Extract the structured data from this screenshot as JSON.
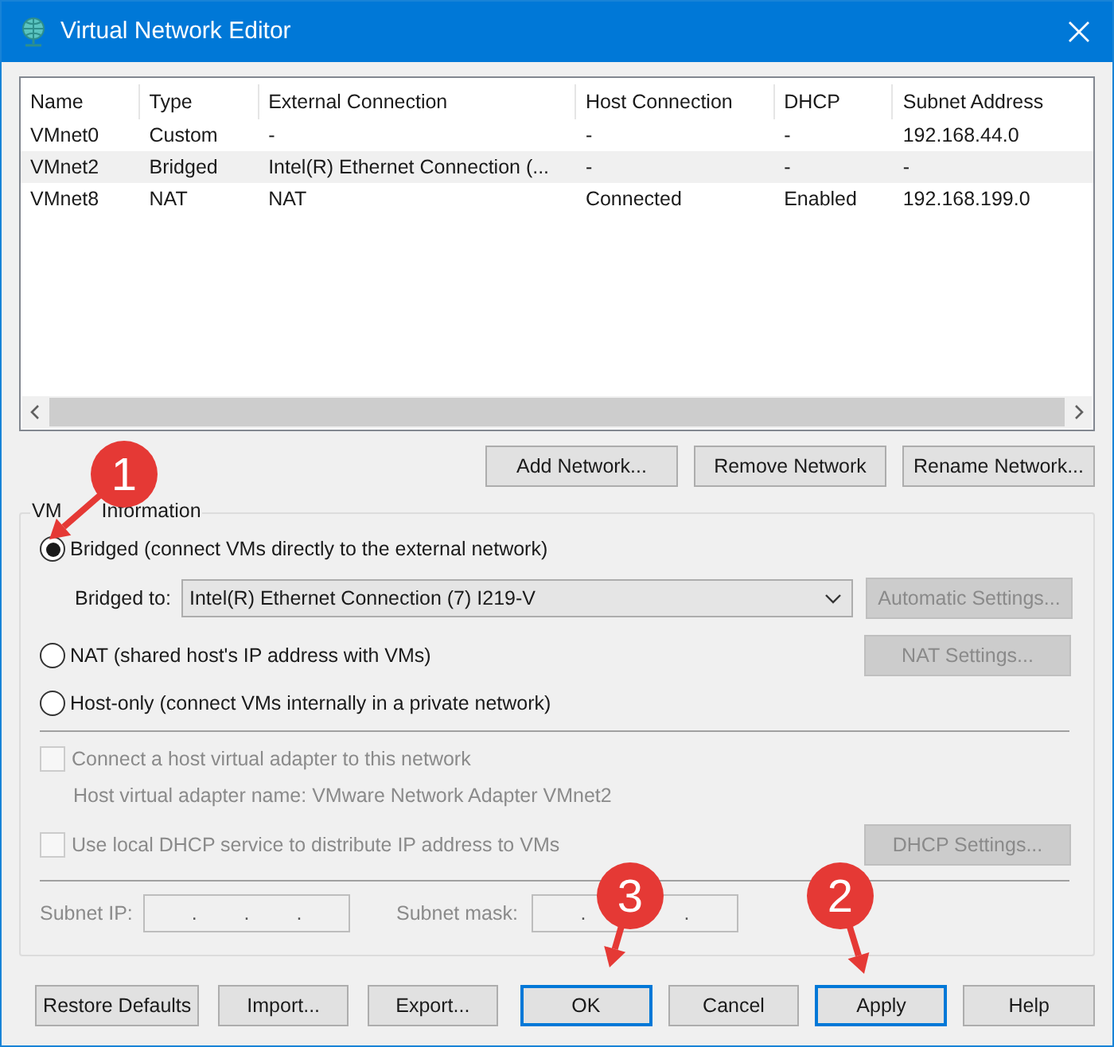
{
  "window": {
    "title": "Virtual Network Editor"
  },
  "table": {
    "columns": [
      "Name",
      "Type",
      "External Connection",
      "Host Connection",
      "DHCP",
      "Subnet Address"
    ],
    "rows": [
      {
        "cells": [
          "VMnet0",
          "Custom",
          "-",
          "-",
          "-",
          "192.168.44.0"
        ],
        "selected": false
      },
      {
        "cells": [
          "VMnet2",
          "Bridged",
          "Intel(R) Ethernet Connection (...",
          "-",
          "-",
          "-"
        ],
        "selected": true
      },
      {
        "cells": [
          "VMnet8",
          "NAT",
          "NAT",
          "Connected",
          "Enabled",
          "192.168.199.0"
        ],
        "selected": false
      }
    ]
  },
  "network_buttons": [
    "Add Network...",
    "Remove Network",
    "Rename Network..."
  ],
  "vmnet_information": {
    "legend": [
      "VM",
      "Information"
    ],
    "bridged": {
      "label": "Bridged (connect VMs directly to the external network)",
      "selected": true
    },
    "bridged_to": {
      "label": "Bridged to:",
      "value": "Intel(R) Ethernet Connection (7) I219-V"
    },
    "automatic_settings": {
      "label": "Automatic Settings...",
      "disabled": true
    },
    "nat": {
      "label": "NAT (shared host's IP address with VMs)",
      "selected": false
    },
    "nat_settings": {
      "label": "NAT Settings...",
      "disabled": true
    },
    "host_only": {
      "label": "Host-only (connect VMs internally in a private network)",
      "selected": false
    },
    "connect_adapter": {
      "label": "Connect a host virtual adapter to this network",
      "checked": false,
      "disabled": true
    },
    "adapter_name": "Host virtual adapter name: VMware Network Adapter VMnet2",
    "use_dhcp": {
      "label": "Use local DHCP service to distribute IP address to VMs",
      "checked": false,
      "disabled": true
    },
    "dhcp_settings": {
      "label": "DHCP Settings...",
      "disabled": true
    },
    "subnet_ip": {
      "label": "Subnet IP:",
      "value": ". . ."
    },
    "subnet_mask": {
      "label": "Subnet mask:",
      "value": ". ."
    }
  },
  "footer_buttons": [
    {
      "label": "Restore Defaults",
      "highlighted": false
    },
    {
      "label": "Import...",
      "highlighted": false
    },
    {
      "label": "Export...",
      "highlighted": false
    },
    {
      "label": "OK",
      "highlighted": true
    },
    {
      "label": "Cancel",
      "highlighted": false
    },
    {
      "label": "Apply",
      "highlighted": true
    },
    {
      "label": "Help",
      "highlighted": false
    }
  ],
  "callouts": [
    {
      "label": "1"
    },
    {
      "label": "2"
    },
    {
      "label": "3"
    }
  ]
}
